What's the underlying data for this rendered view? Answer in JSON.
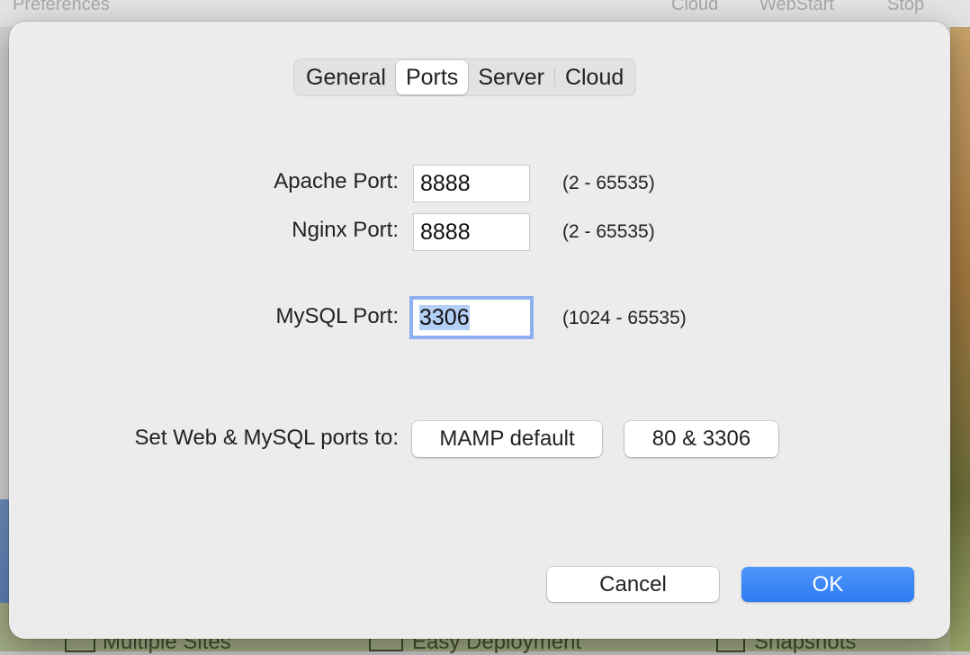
{
  "background_window": {
    "toolbar": {
      "title": "Preferences",
      "items": [
        "Cloud",
        "WebStart",
        "Stop"
      ]
    },
    "features": [
      "Multiple Sites",
      "Easy Deployment",
      "Snapshots"
    ]
  },
  "dialog": {
    "tabs": [
      {
        "label": "General",
        "selected": false
      },
      {
        "label": "Ports",
        "selected": true
      },
      {
        "label": "Server",
        "selected": false
      },
      {
        "label": "Cloud",
        "selected": false
      }
    ],
    "ports": {
      "apache": {
        "label": "Apache Port:",
        "value": "8888",
        "range": "(2 - 65535)"
      },
      "nginx": {
        "label": "Nginx Port:",
        "value": "8888",
        "range": "(2 - 65535)"
      },
      "mysql": {
        "label": "MySQL Port:",
        "value": "3306",
        "range": "(1024 - 65535)"
      }
    },
    "presets": {
      "label": "Set Web & MySQL ports to:",
      "mamp_default": "MAMP default",
      "eighty": "80 & 3306"
    },
    "buttons": {
      "cancel": "Cancel",
      "ok": "OK"
    }
  },
  "colors": {
    "accent": "#2d7bf4",
    "focus_ring": "#8db0f0",
    "selection": "#b4cff6"
  }
}
